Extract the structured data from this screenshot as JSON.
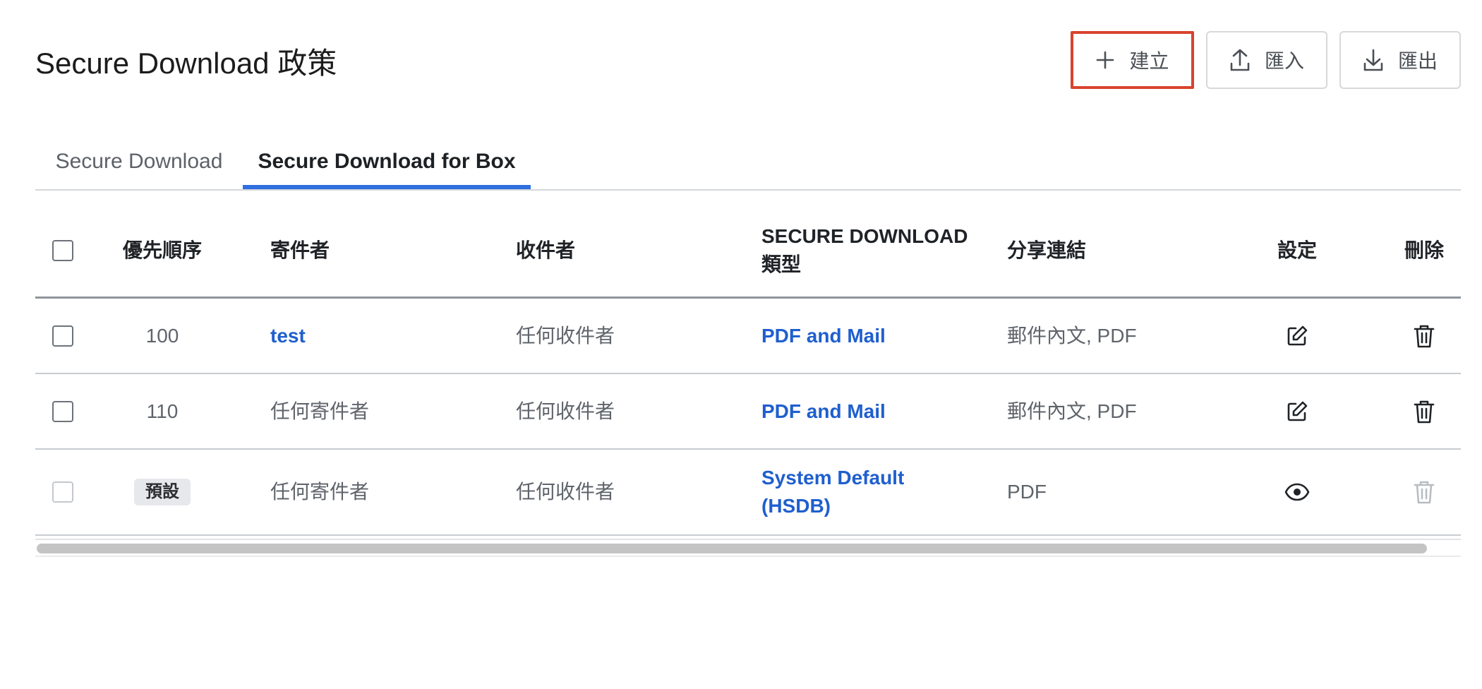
{
  "page": {
    "title": "Secure Download 政策"
  },
  "toolbar": {
    "create_label": "建立",
    "import_label": "匯入",
    "export_label": "匯出"
  },
  "tabs": [
    {
      "label": "Secure Download",
      "active": false
    },
    {
      "label": "Secure Download for Box",
      "active": true
    }
  ],
  "table": {
    "headers": {
      "priority": "優先順序",
      "sender": "寄件者",
      "recipient": "收件者",
      "type_line1": "SECURE DOWNLOAD",
      "type_line2": "類型",
      "share_link": "分享連結",
      "settings": "設定",
      "delete": "刪除"
    },
    "rows": [
      {
        "priority": "100",
        "sender": "test",
        "recipient": "任何收件者",
        "type": "PDF and Mail",
        "share_link": "郵件內文, PDF",
        "settings_icon": "edit-icon",
        "delete_icon": "trash-icon"
      },
      {
        "priority": "110",
        "sender": "任何寄件者",
        "recipient": "任何收件者",
        "type": "PDF and Mail",
        "share_link": "郵件內文, PDF",
        "settings_icon": "edit-icon",
        "delete_icon": "trash-icon"
      },
      {
        "priority": "預設",
        "sender": "任何寄件者",
        "recipient": "任何收件者",
        "type_line1": "System Default",
        "type_line2": "(HSDB)",
        "share_link": "PDF",
        "settings_icon": "eye-icon",
        "delete_icon": "trash-icon"
      }
    ]
  },
  "colors": {
    "accent": "#2f6fe0",
    "link": "#1f5fce",
    "highlight": "#d8432d"
  }
}
